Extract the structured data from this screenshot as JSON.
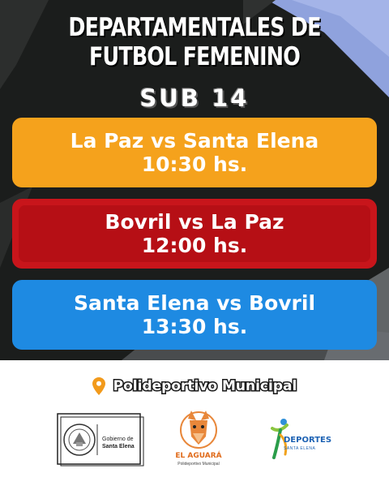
{
  "header": {
    "title_line1": "DEPARTAMENTALES DE",
    "title_line2": "FUTBOL FEMENINO",
    "category": "SUB 14"
  },
  "matches": [
    {
      "teams": "La Paz vs Santa Elena",
      "time": "10:30 hs.",
      "color": "#f5a21c"
    },
    {
      "teams": "Bovril vs La Paz",
      "time": "12:00 hs.",
      "color": "#c8151b"
    },
    {
      "teams": "Santa Elena vs Bovril",
      "time": "13:30 hs.",
      "color": "#1e8ae2"
    }
  ],
  "venue": {
    "icon": "location-pin-icon",
    "name": "Polideportivo Municipal",
    "pin_color": "#f29a1b"
  },
  "logos": {
    "government": {
      "line1": "Gobierno de",
      "line2": "Santa Elena"
    },
    "aguara": {
      "name": "EL AGUARÁ",
      "subtitle": "Polideportivo Municipal"
    },
    "deportes": {
      "name": "DEPORTES",
      "subtitle": "SANTA ELENA"
    }
  },
  "colors": {
    "background": "#1b1d1c",
    "brush_accent": "#8fa2dd"
  }
}
